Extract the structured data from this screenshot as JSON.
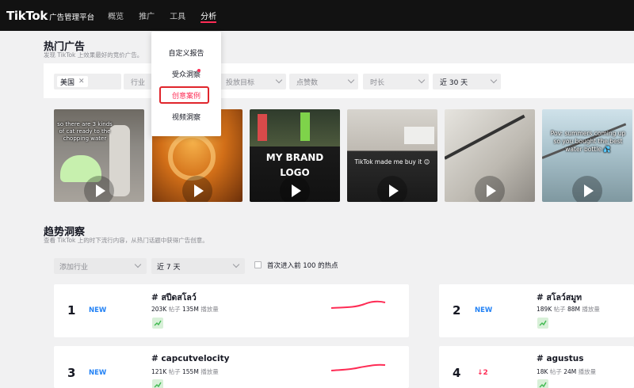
{
  "app": {
    "logo": "TikTok",
    "logo_sub": "广告管理平台",
    "nav": [
      "概览",
      "推广",
      "工具",
      "分析"
    ],
    "nav_active": "分析",
    "accent": "#fe2c55"
  },
  "top_ads": {
    "title": "热门广告",
    "subtitle": "发现 TikTok 上效果最好的竞价广告。",
    "filters": {
      "region_tag": "美国",
      "industry": "行业",
      "objective": "投放目标",
      "likes": "点赞数",
      "duration": "时长",
      "period": "近 30 天"
    },
    "cards": [
      {
        "caption": "so there are 3 kinds of cat ready to the chopping water",
        "play_icon": "play-icon"
      },
      {
        "caption": "",
        "play_icon": "play-icon"
      },
      {
        "caption": "MY BRAND LOGO",
        "play_icon": "play-icon"
      },
      {
        "caption": "TikTok made me buy it 😊",
        "play_icon": "play-icon"
      },
      {
        "caption": "",
        "play_icon": "play-icon"
      },
      {
        "caption": "Pov: summers coming up so you bought the best water bottle 💦",
        "play_icon": "play-icon"
      }
    ]
  },
  "menu": {
    "items": [
      "自定义报告",
      "受众洞察",
      "创意案例",
      "视频洞察"
    ],
    "highlighted": "创意案例"
  },
  "trends": {
    "title": "趋势洞察",
    "subtitle": "查看 TikTok 上的时下流行内容，从热门话题中获得广告创意。",
    "industry_placeholder": "添加行业",
    "period": "近 7 天",
    "checkbox_label": "首次进入前 100 的热点",
    "stats_posts_unit": "帖子",
    "stats_views_unit": "播放量",
    "items": [
      {
        "rank": "1",
        "badge": "NEW",
        "name": "# สปีดสโลว์",
        "posts": "203K",
        "views": "135M"
      },
      {
        "rank": "2",
        "badge": "NEW",
        "name": "# สโลว์สมูท",
        "posts": "189K",
        "views": "88M"
      },
      {
        "rank": "3",
        "badge": "NEW",
        "name": "# capcutvelocity",
        "posts": "121K",
        "views": "155M"
      },
      {
        "rank": "4",
        "badge": "↓2",
        "name": "# agustus",
        "posts": "18K",
        "views": "24M"
      }
    ]
  }
}
